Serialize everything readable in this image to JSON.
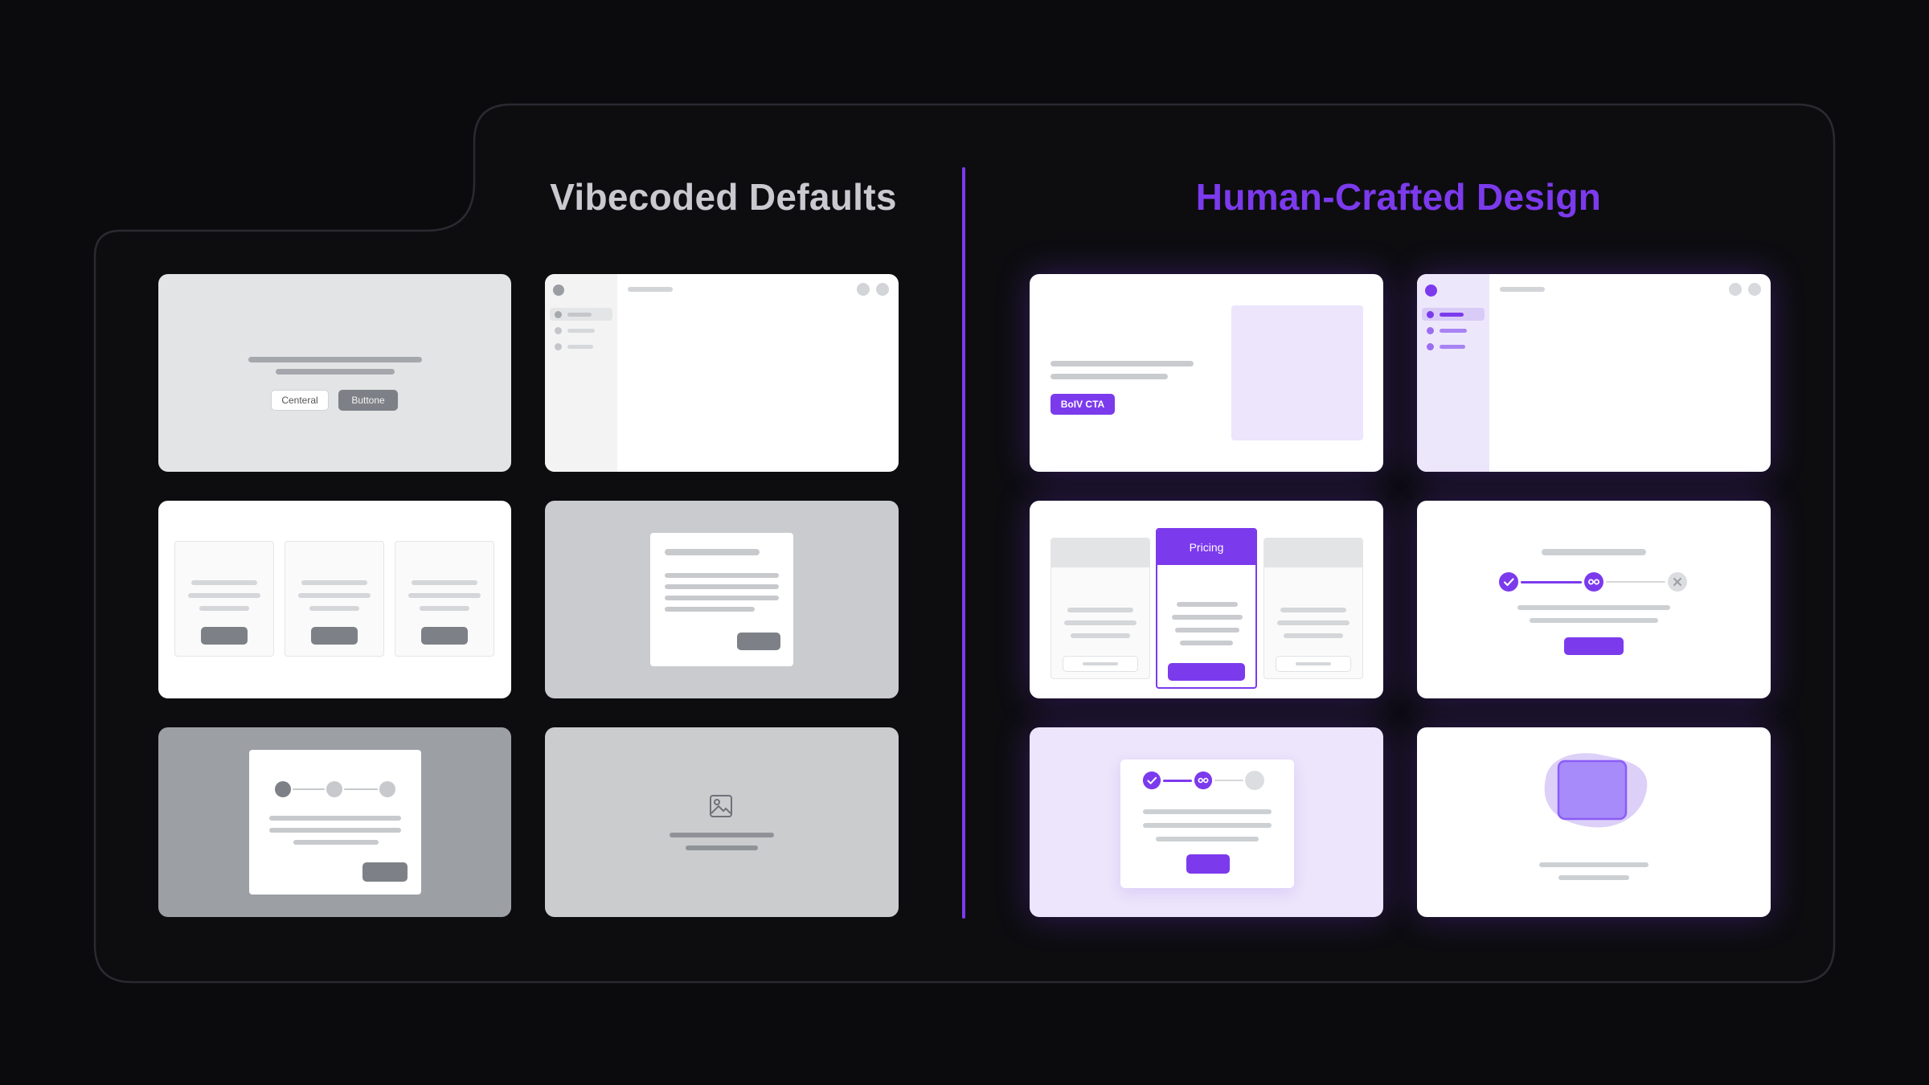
{
  "headings": {
    "left": "Vibecoded Defaults",
    "right": "Human-Crafted Design"
  },
  "colors": {
    "background": "#0b0b0d",
    "panel_border": "#2b2a31",
    "left_heading": "#c9c9cf",
    "accent": "#7c3aed",
    "accent_light": "#ede7fb",
    "gray_button": "#7d8187",
    "divider": "#7c3aed"
  },
  "cards": {
    "left": {
      "centered_buttons": {
        "button_a": "Centeral",
        "button_b": "Buttone"
      },
      "sidebar_window": {
        "icon": "window-controls-icon"
      },
      "three_cards": {
        "count": 3
      },
      "modal_card": {
        "icon": "dialog-icon"
      },
      "stepper_modal": {
        "steps": 3
      },
      "image_placeholder": {
        "icon": "image-icon"
      }
    },
    "right": {
      "hero_cta": {
        "button": "BoIV CTA"
      },
      "sidebar_window": {
        "active_item": 1
      },
      "pricing": {
        "highlight_label": "Pricing"
      },
      "progress_steps": {
        "steps": 3,
        "complete_icon": "check-icon",
        "current_icon": "active-step-icon",
        "pending_icon": "x-icon"
      },
      "stepper_card": {
        "steps": 3,
        "complete_icon": "check-icon",
        "current_icon": "active-step-icon"
      },
      "blob_illustration": {
        "icon": "blob-square-icon"
      }
    }
  }
}
